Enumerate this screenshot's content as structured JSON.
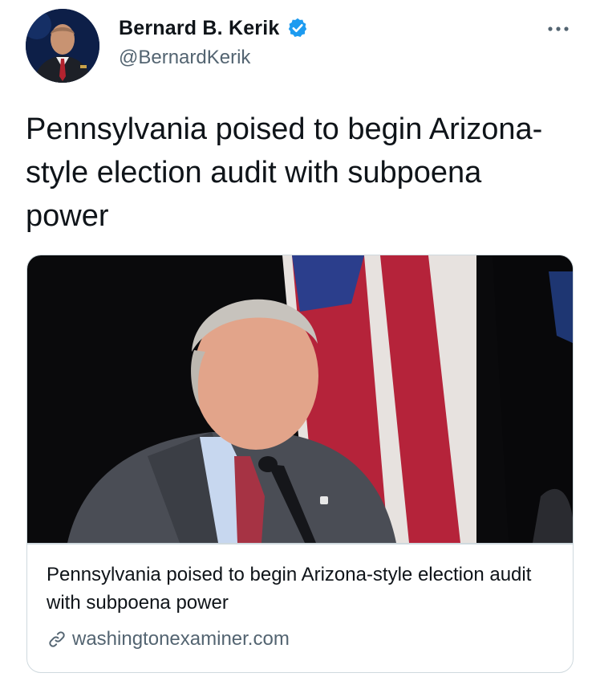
{
  "tweet": {
    "author": {
      "display_name": "Bernard B. Kerik",
      "handle": "@BernardKerik",
      "verified_icon": "verified-badge-icon",
      "avatar": "profile-photo"
    },
    "more_icon": "more-horizontal-icon",
    "text": "Pennsylvania poised to begin Arizona-style election audit with subpoena power",
    "card": {
      "image": "man-speaking-at-microphone-with-flag",
      "title": "Pennsylvania poised to begin Arizona-style election audit with subpoena power",
      "domain_icon": "link-icon",
      "domain": "washingtonexaminer.com"
    }
  },
  "colors": {
    "text_primary": "#0f1419",
    "text_secondary": "#536471",
    "verified_blue": "#1d9bf0",
    "card_border": "#cfd9de"
  }
}
